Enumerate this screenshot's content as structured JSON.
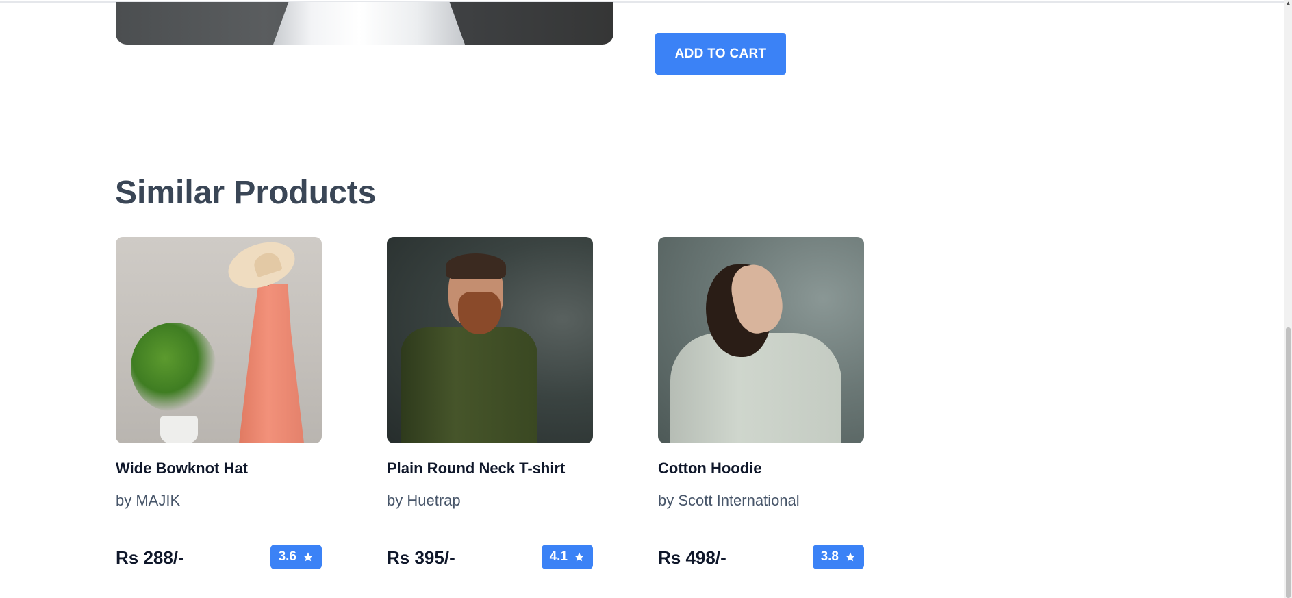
{
  "product": {
    "add_to_cart_label": "ADD TO CART"
  },
  "similar": {
    "title": "Similar Products",
    "items": [
      {
        "name": "Wide Bowknot Hat",
        "brand": "by MAJIK",
        "price": "Rs 288/-",
        "rating": "3.6"
      },
      {
        "name": "Plain Round Neck T-shirt",
        "brand": "by Huetrap",
        "price": "Rs 395/-",
        "rating": "4.1"
      },
      {
        "name": "Cotton Hoodie",
        "brand": "by Scott International",
        "price": "Rs 498/-",
        "rating": "3.8"
      }
    ]
  },
  "icons": {
    "rating": "star-icon",
    "scroll_up": "scroll-up-arrow"
  },
  "colors": {
    "accent": "#3b82f6",
    "heading": "#3a4656",
    "text_dark": "#0f172a",
    "text_muted": "#475569"
  }
}
